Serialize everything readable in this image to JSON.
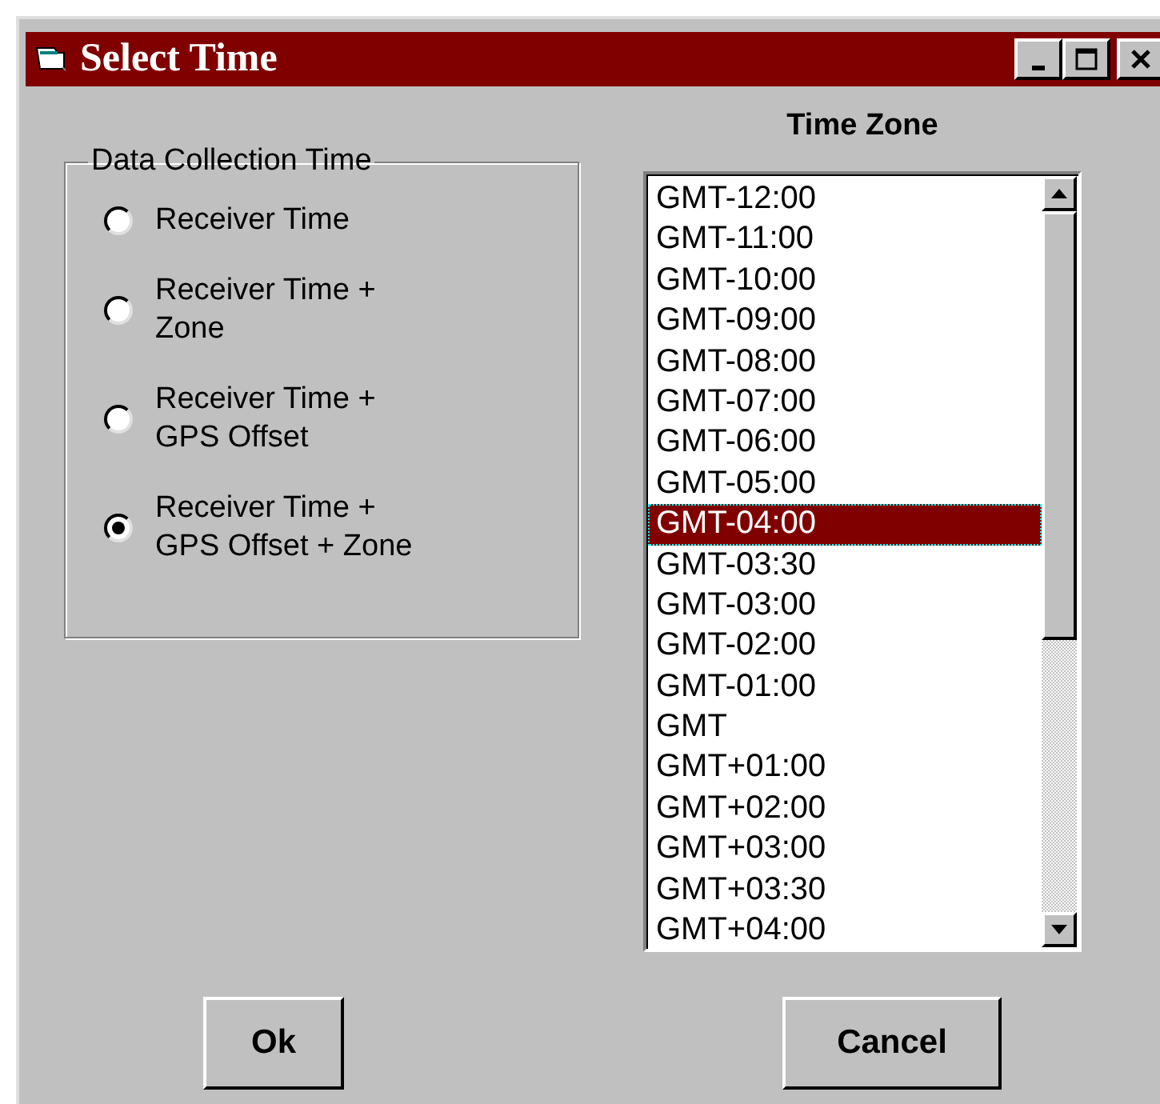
{
  "window": {
    "title": "Select Time"
  },
  "collection_group": {
    "title": "Data Collection Time",
    "options": [
      {
        "label": "Receiver Time",
        "selected": false
      },
      {
        "label": "Receiver Time +\nZone",
        "selected": false
      },
      {
        "label": "Receiver Time +\nGPS Offset",
        "selected": false
      },
      {
        "label": "Receiver Time +\nGPS Offset + Zone",
        "selected": true
      }
    ]
  },
  "time_zone": {
    "label": "Time Zone",
    "items": [
      {
        "label": "GMT-12:00",
        "selected": false
      },
      {
        "label": "GMT-11:00",
        "selected": false
      },
      {
        "label": "GMT-10:00",
        "selected": false
      },
      {
        "label": "GMT-09:00",
        "selected": false
      },
      {
        "label": "GMT-08:00",
        "selected": false
      },
      {
        "label": "GMT-07:00",
        "selected": false
      },
      {
        "label": "GMT-06:00",
        "selected": false
      },
      {
        "label": "GMT-05:00",
        "selected": false
      },
      {
        "label": "GMT-04:00",
        "selected": true
      },
      {
        "label": "GMT-03:30",
        "selected": false
      },
      {
        "label": "GMT-03:00",
        "selected": false
      },
      {
        "label": "GMT-02:00",
        "selected": false
      },
      {
        "label": "GMT-01:00",
        "selected": false
      },
      {
        "label": "GMT",
        "selected": false
      },
      {
        "label": "GMT+01:00",
        "selected": false
      },
      {
        "label": "GMT+02:00",
        "selected": false
      },
      {
        "label": "GMT+03:00",
        "selected": false
      },
      {
        "label": "GMT+03:30",
        "selected": false
      },
      {
        "label": "GMT+04:00",
        "selected": false
      }
    ]
  },
  "buttons": [
    "Ok",
    "Cancel"
  ]
}
